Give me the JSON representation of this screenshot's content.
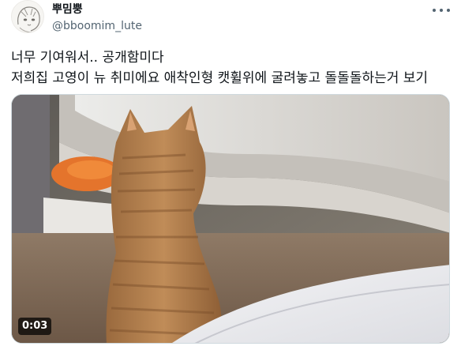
{
  "author": {
    "display_name": "뿌밈뿡",
    "handle": "@bboomim_lute",
    "avatar_icon": "anime-sketch-avatar"
  },
  "header": {
    "more_icon": "more-horizontal-icon"
  },
  "tweet": {
    "lines": [
      "너무 기여워서.. 공개함미다",
      "저희집 고영이 뉴 취미에요 애착인형 캣휠위에 굴려놓고 돌돌돌하는거 보기"
    ]
  },
  "media": {
    "type": "video",
    "duration": "0:03",
    "subject_icon": "orange-tabby-cat-icon"
  },
  "colors": {
    "text_primary": "#0f1419",
    "text_secondary": "#536471",
    "border": "#cfd9de"
  }
}
